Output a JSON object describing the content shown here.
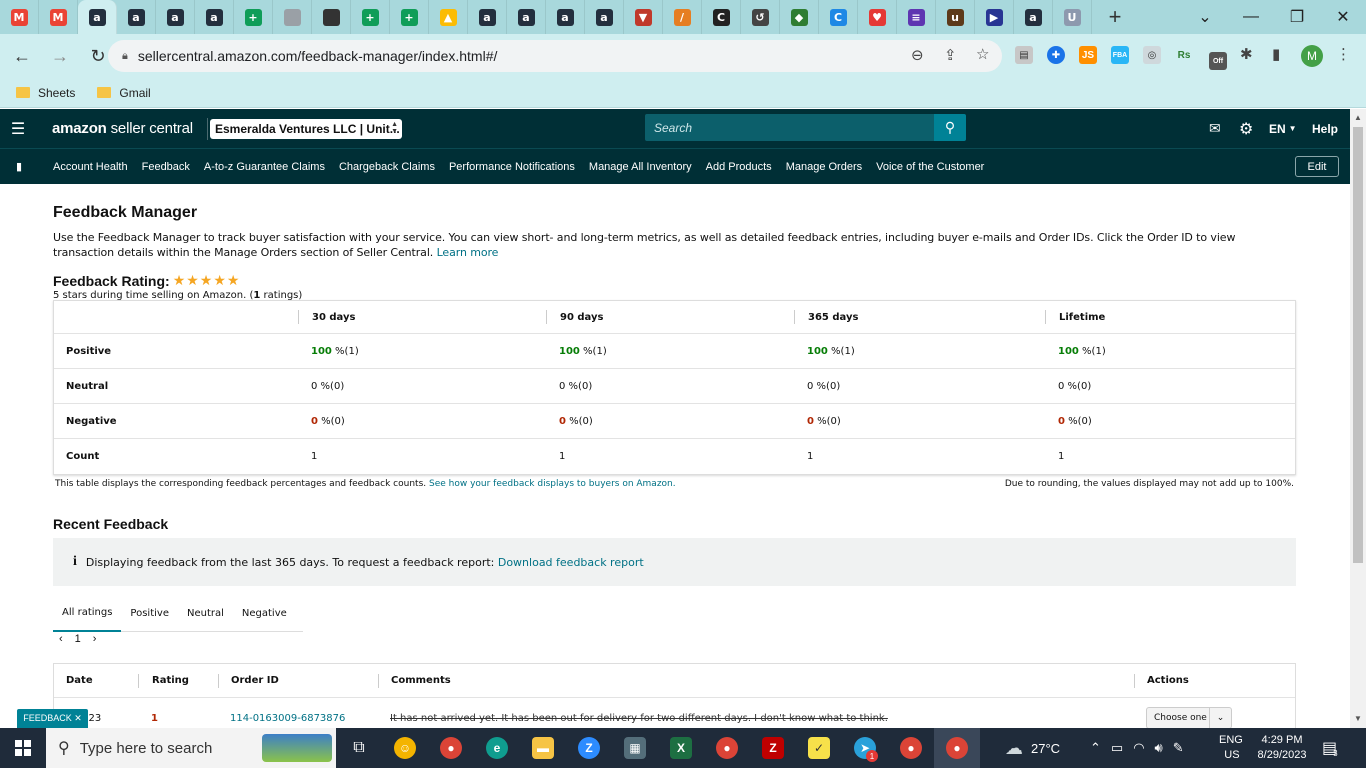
{
  "browser": {
    "favicons": [
      {
        "icon": "gmail-icon",
        "glyph": "M",
        "color": "#ea4335"
      },
      {
        "icon": "gmail-icon",
        "glyph": "M",
        "color": "#ea4335"
      },
      {
        "icon": "amazon-icon",
        "glyph": "a",
        "color": "#232f3e"
      },
      {
        "icon": "amazon-icon",
        "glyph": "a",
        "color": "#232f3e"
      },
      {
        "icon": "amazon-icon",
        "glyph": "a",
        "color": "#232f3e"
      },
      {
        "icon": "amazon-icon",
        "glyph": "a",
        "color": "#232f3e"
      },
      {
        "icon": "sheets-icon",
        "glyph": "+",
        "color": "#0f9d58"
      },
      {
        "icon": "globe-icon",
        "glyph": "",
        "color": "#9aa0a6"
      },
      {
        "icon": "person-icon",
        "glyph": "",
        "color": "#333333"
      },
      {
        "icon": "sheets-icon",
        "glyph": "+",
        "color": "#0f9d58"
      },
      {
        "icon": "sheets-icon",
        "glyph": "+",
        "color": "#0f9d58"
      },
      {
        "icon": "drive-icon",
        "glyph": "▲",
        "color": "#fbbc04"
      },
      {
        "icon": "amazon-icon",
        "glyph": "a",
        "color": "#232f3e"
      },
      {
        "icon": "amazon-icon",
        "glyph": "a",
        "color": "#232f3e"
      },
      {
        "icon": "amazon-icon",
        "glyph": "a",
        "color": "#232f3e"
      },
      {
        "icon": "amazon-icon",
        "glyph": "a",
        "color": "#232f3e"
      },
      {
        "icon": "shield-icon",
        "glyph": "▼",
        "color": "#c0392b"
      },
      {
        "icon": "pen-icon",
        "glyph": "/",
        "color": "#e67e22"
      },
      {
        "icon": "circle-c-icon",
        "glyph": "C",
        "color": "#222222"
      },
      {
        "icon": "history-icon",
        "glyph": "↺",
        "color": "#444444"
      },
      {
        "icon": "leaf-icon",
        "glyph": "◆",
        "color": "#2e7d32"
      },
      {
        "icon": "c-icon",
        "glyph": "C",
        "color": "#1e88e5"
      },
      {
        "icon": "heart-icon",
        "glyph": "♥",
        "color": "#e53935"
      },
      {
        "icon": "list-icon",
        "glyph": "≡",
        "color": "#5e35b1"
      },
      {
        "icon": "ups-icon",
        "glyph": "u",
        "color": "#5d3a1a"
      },
      {
        "icon": "usps-icon",
        "glyph": "▶",
        "color": "#283593"
      },
      {
        "icon": "amazon-icon",
        "glyph": "a",
        "color": "#232f3e"
      },
      {
        "icon": "uline-icon",
        "glyph": "U",
        "color": "#8d99ae"
      }
    ],
    "url": "sellercentral.amazon.com/feedback-manager/index.html#/",
    "bookmarks": [
      "Sheets",
      "Gmail"
    ],
    "profile_initial": "M"
  },
  "header": {
    "logo_brand": "amazon",
    "logo_rest": " seller central",
    "account": "Esmeralda Ventures LLC | Unit...",
    "search_placeholder": "Search",
    "language": "EN",
    "help": "Help"
  },
  "nav": {
    "items": [
      "Account Health",
      "Feedback",
      "A-to-z Guarantee Claims",
      "Chargeback Claims",
      "Performance Notifications",
      "Manage All Inventory",
      "Add Products",
      "Manage Orders",
      "Voice of the Customer"
    ],
    "edit": "Edit"
  },
  "page": {
    "title": "Feedback Manager",
    "description": "Use the Feedback Manager to track buyer satisfaction with your service. You can view short- and long-term metrics, as well as detailed feedback entries, including buyer e-mails and Order IDs. Click the Order ID to view transaction details within the Manage Orders section of Seller Central.",
    "learn_more": "Learn more",
    "rating_label": "Feedback Rating:",
    "stars": "★★★★★",
    "rating_sub_prefix": "5 stars during time selling on Amazon. (",
    "rating_count": "1",
    "rating_sub_suffix": " ratings)"
  },
  "metrics": {
    "columns": [
      "30 days",
      "90 days",
      "365 days",
      "Lifetime"
    ],
    "rows": [
      {
        "label": "Positive",
        "cells": [
          {
            "v": "100",
            "rest": " %(1)"
          },
          {
            "v": "100",
            "rest": " %(1)"
          },
          {
            "v": "100",
            "rest": " %(1)"
          },
          {
            "v": "100",
            "rest": " %(1)"
          }
        ]
      },
      {
        "label": "Neutral",
        "cells": [
          {
            "v": "0",
            "rest": " %(0)"
          },
          {
            "v": "0",
            "rest": " %(0)"
          },
          {
            "v": "0",
            "rest": " %(0)"
          },
          {
            "v": "0",
            "rest": " %(0)"
          }
        ]
      },
      {
        "label": "Negative",
        "cells": [
          {
            "v": "0",
            "rest": " %(0)"
          },
          {
            "v": "0",
            "rest": " %(0)"
          },
          {
            "v": "0",
            "rest": " %(0)"
          },
          {
            "v": "0",
            "rest": " %(0)"
          }
        ]
      },
      {
        "label": "Count",
        "cells": [
          {
            "v": "1",
            "rest": ""
          },
          {
            "v": "1",
            "rest": ""
          },
          {
            "v": "1",
            "rest": ""
          },
          {
            "v": "1",
            "rest": ""
          }
        ]
      }
    ],
    "note_left": "This table displays the corresponding feedback percentages and feedback counts.",
    "note_link": "See how your feedback displays to buyers on Amazon.",
    "note_right": "Due to rounding, the values displayed may not add up to 100%."
  },
  "recent": {
    "title": "Recent Feedback",
    "info": "Displaying feedback from the last 365 days. To request a feedback report:",
    "download": "Download feedback report",
    "tabs": [
      "All ratings",
      "Positive",
      "Neutral",
      "Negative"
    ],
    "page": "1",
    "columns": [
      "Date",
      "Rating",
      "Order ID",
      "Comments",
      "Actions"
    ],
    "rows": [
      {
        "date": "0/2023",
        "rating": "1",
        "order_id": "114-0163009-6873876",
        "comment": "It has not arrived yet. It has been out for delivery for two different days. I don't know what to think.",
        "action": "Choose one"
      }
    ]
  },
  "feedback_tag": "FEEDBACK ✕",
  "taskbar": {
    "search_placeholder": "Type here to search",
    "temperature": "27°C",
    "lang_top": "ENG",
    "lang_bottom": "US",
    "time": "4:29 PM",
    "date": "8/29/2023",
    "notifications": "3",
    "badge": "1"
  }
}
